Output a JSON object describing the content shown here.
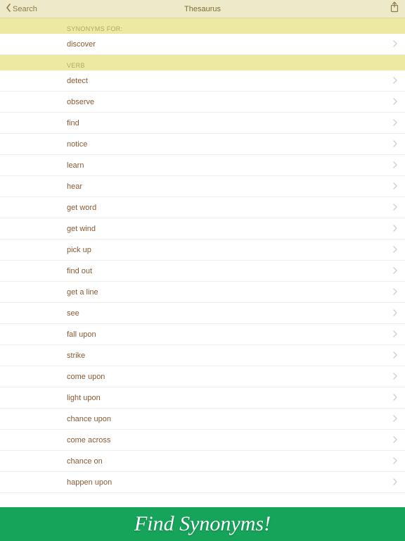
{
  "nav": {
    "back_label": "Search",
    "title": "Thesaurus"
  },
  "sections": [
    {
      "header": "SYNONYMS FOR:",
      "rows": [
        "discover"
      ]
    },
    {
      "header": "VERB",
      "rows": [
        "detect",
        "observe",
        "find",
        "notice",
        "learn",
        "hear",
        "get word",
        "get wind",
        "pick up",
        "find out",
        "get a line",
        "see",
        "fall upon",
        "strike",
        "come upon",
        "light upon",
        "chance upon",
        "come across",
        "chance on",
        "happen upon"
      ]
    }
  ],
  "banner_text": "Find Synonyms!"
}
